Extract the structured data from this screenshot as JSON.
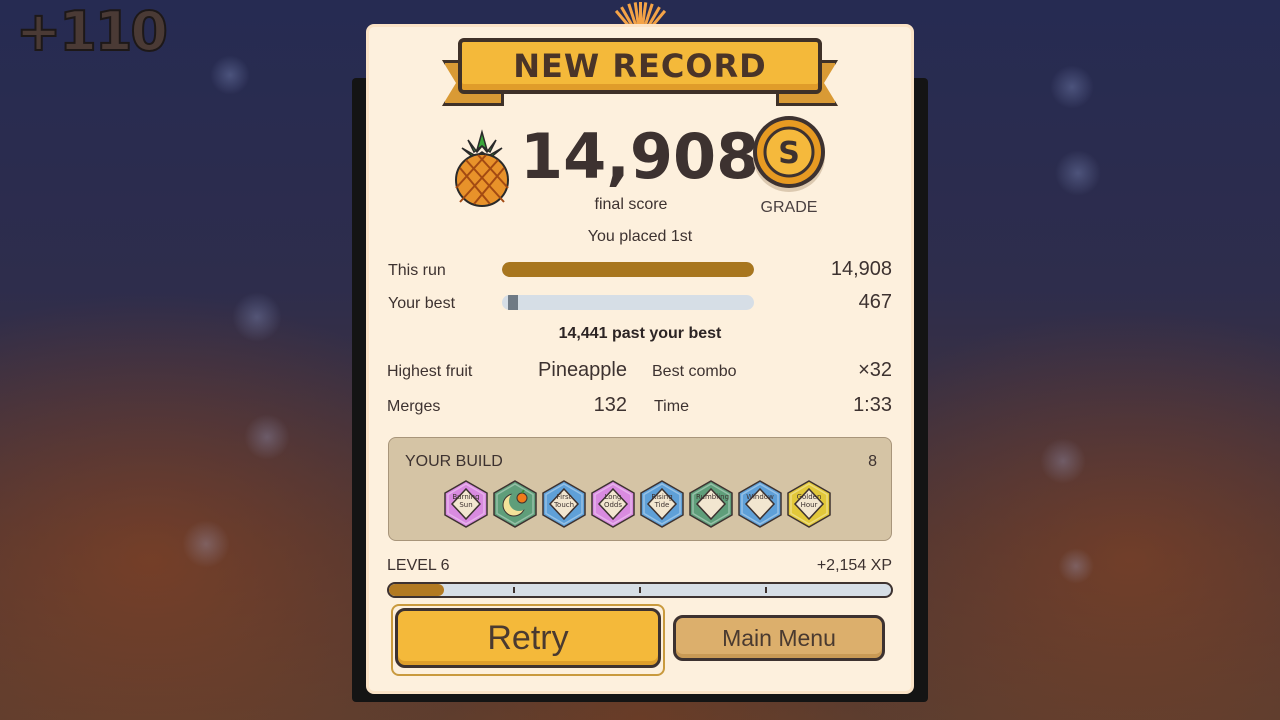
{
  "combo_popup": "+110",
  "banner": {
    "title": "NEW RECORD"
  },
  "score": {
    "value": "14,908",
    "label": "final score"
  },
  "grade": {
    "letter": "S",
    "label": "GRADE"
  },
  "placement": "You placed 1st",
  "comparison": {
    "this_run": {
      "label": "This run",
      "value": "14,908",
      "fraction": 1.0
    },
    "your_best": {
      "label": "Your best",
      "value": "467",
      "fraction": 0.031
    },
    "delta_text": "14,441 past your best"
  },
  "stats": {
    "highest_fruit": {
      "label": "Highest fruit",
      "value": "Pineapple"
    },
    "best_combo": {
      "label": "Best combo",
      "value": "×32"
    },
    "merges": {
      "label": "Merges",
      "value": "132"
    },
    "time": {
      "label": "Time",
      "value": "1:33"
    }
  },
  "build": {
    "title": "YOUR BUILD",
    "count": "8",
    "items": [
      {
        "text": "Burning Sun",
        "color": "#d98be0",
        "icon": "diamond-icon"
      },
      {
        "text": "",
        "color": "#5f9e7a",
        "icon": "moon-orange-icon"
      },
      {
        "text": "First Touch",
        "color": "#5fa0d8",
        "icon": "diamond-icon"
      },
      {
        "text": "Long Odds",
        "color": "#d98be0",
        "icon": "diamond-icon"
      },
      {
        "text": "Rising Tide",
        "color": "#5fa0d8",
        "icon": "diamond-icon"
      },
      {
        "text": "Rumbling",
        "color": "#5f9e7a",
        "icon": "diamond-icon"
      },
      {
        "text": "Window",
        "color": "#5fa0d8",
        "icon": "diamond-icon"
      },
      {
        "text": "Golden Hour",
        "color": "#e2c83a",
        "icon": "diamond-icon"
      }
    ]
  },
  "progress": {
    "level": "LEVEL 6",
    "xp": "+2,154 XP",
    "fraction": 0.11
  },
  "buttons": {
    "retry": "Retry",
    "main_menu": "Main Menu"
  },
  "colors": {
    "accent": "#f4b93a",
    "panel": "#fdf0dd",
    "bar_fill": "#a8761e"
  }
}
